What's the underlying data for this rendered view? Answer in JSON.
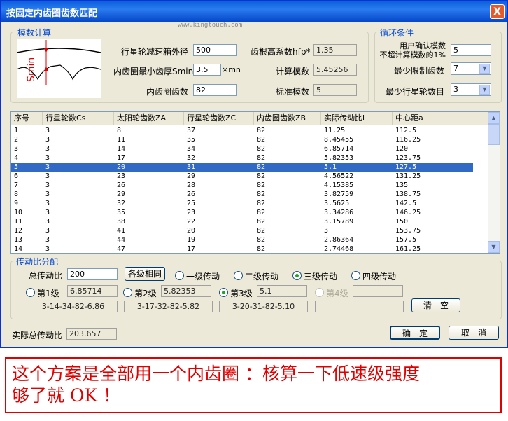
{
  "window": {
    "title": "按固定内齿圈齿数匹配",
    "close": "X",
    "watermark": "www.kingtouch.com"
  },
  "module_calc": {
    "group_label": "模数计算",
    "diagram_label": "Smin",
    "outer_diameter_label": "行星轮减速箱外径",
    "outer_diameter_value": "500",
    "min_thickness_label": "内齿圈最小齿厚Smin",
    "min_thickness_value": "3.5",
    "min_thickness_unit": "×mn",
    "ring_teeth_label": "内齿圈齿数",
    "ring_teeth_value": "82",
    "hfp_label": "齿根高系数hfp*",
    "hfp_value": "1.35",
    "calc_module_label": "计算模数",
    "calc_module_value": "5.45256",
    "std_module_label": "标准模数",
    "std_module_value": "5"
  },
  "loop": {
    "group_label": "循环条件",
    "user_module_label_1": "用户确认模数",
    "user_module_label_2": "不超计算模数的1%",
    "user_module_value": "5",
    "min_limit_label": "最少限制齿数",
    "min_limit_value": "7",
    "min_planet_label": "最少行星轮数目",
    "min_planet_value": "3"
  },
  "table": {
    "headers": [
      "序号",
      "行星轮数Cs",
      "太阳轮齿数ZA",
      "行星轮齿数ZC",
      "内齿圈齿数ZB",
      "实际传动比i",
      "中心距a"
    ],
    "rows": [
      [
        "1",
        "3",
        "8",
        "37",
        "82",
        "11.25",
        "112.5"
      ],
      [
        "2",
        "3",
        "11",
        "35",
        "82",
        "8.45455",
        "116.25"
      ],
      [
        "3",
        "3",
        "14",
        "34",
        "82",
        "6.85714",
        "120"
      ],
      [
        "4",
        "3",
        "17",
        "32",
        "82",
        "5.82353",
        "123.75"
      ],
      [
        "5",
        "3",
        "20",
        "31",
        "82",
        "5.1",
        "127.5"
      ],
      [
        "6",
        "3",
        "23",
        "29",
        "82",
        "4.56522",
        "131.25"
      ],
      [
        "7",
        "3",
        "26",
        "28",
        "82",
        "4.15385",
        "135"
      ],
      [
        "8",
        "3",
        "29",
        "26",
        "82",
        "3.82759",
        "138.75"
      ],
      [
        "9",
        "3",
        "32",
        "25",
        "82",
        "3.5625",
        "142.5"
      ],
      [
        "10",
        "3",
        "35",
        "23",
        "82",
        "3.34286",
        "146.25"
      ],
      [
        "11",
        "3",
        "38",
        "22",
        "82",
        "3.15789",
        "150"
      ],
      [
        "12",
        "3",
        "41",
        "20",
        "82",
        "3",
        "153.75"
      ],
      [
        "13",
        "3",
        "44",
        "19",
        "82",
        "2.86364",
        "157.5"
      ],
      [
        "14",
        "3",
        "47",
        "17",
        "82",
        "2.74468",
        "161.25"
      ]
    ],
    "selected_row": 4
  },
  "ratio": {
    "group_label": "传动比分配",
    "total_label": "总传动比",
    "total_value": "200",
    "same_button": "各级相同",
    "stage_options": [
      "一级传动",
      "二级传动",
      "三级传动",
      "四级传动"
    ],
    "stage_selected": 2,
    "levels": [
      {
        "label": "第1级",
        "value": "6.85714",
        "scheme": "3-14-34-82-6.86"
      },
      {
        "label": "第2级",
        "value": "5.82353",
        "scheme": "3-17-32-82-5.82"
      },
      {
        "label": "第3级",
        "value": "5.1",
        "scheme": "3-20-31-82-5.10"
      },
      {
        "label": "第4级",
        "value": "",
        "scheme": ""
      }
    ],
    "level_selected": 2,
    "clear_button": "清　空"
  },
  "footer": {
    "actual_total_label": "实际总传动比",
    "actual_total_value": "203.657",
    "ok_button": "确　定",
    "cancel_button": "取　消"
  },
  "note": {
    "line1": "这个方案是全部用一个内齿圈 ：核算一下低速级强度",
    "line2": "够了就 OK ！"
  },
  "colors": {
    "title_bar": "#0a5fd8",
    "selection": "#316ac5",
    "note": "#e00000",
    "group_label": "#0046d5"
  }
}
